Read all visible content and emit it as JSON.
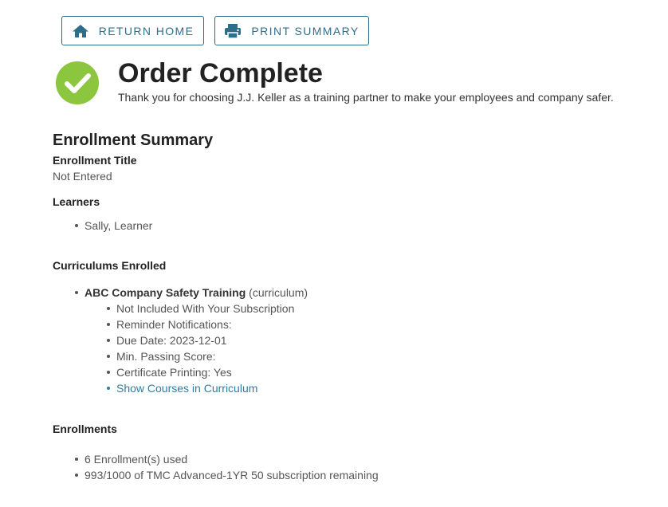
{
  "toolbar": {
    "home_label": "RETURN HOME",
    "home_icon": "home-icon",
    "print_label": "PRINT SUMMARY",
    "print_icon": "printer-icon"
  },
  "header": {
    "icon": "check-circle-icon",
    "title": "Order Complete",
    "subtitle": "Thank you for choosing J.J. Keller as a training partner to make your employees and company safer."
  },
  "summary": {
    "title": "Enrollment Summary",
    "enrollment_title_label": "Enrollment Title",
    "enrollment_title_value": "Not Entered",
    "learners_label": "Learners",
    "learners": [
      "Sally, Learner"
    ],
    "curriculums_label": "Curriculums Enrolled",
    "curriculum": {
      "name": "ABC Company Safety Training",
      "type": "(curriculum)",
      "details": [
        "Not Included With Your Subscription",
        "Reminder Notifications:",
        "Due Date: 2023-12-01",
        "Min. Passing Score:",
        "Certificate Printing: Yes"
      ],
      "link_label": "Show Courses in Curriculum"
    },
    "enrollments_label": "Enrollments",
    "enrollments": [
      "6 Enrollment(s) used",
      "993/1000 of TMC Advanced-1YR 50 subscription remaining"
    ]
  },
  "colors": {
    "accent": "#2e6e8a",
    "link": "#2e7ea2",
    "success": "#8cc63f"
  }
}
